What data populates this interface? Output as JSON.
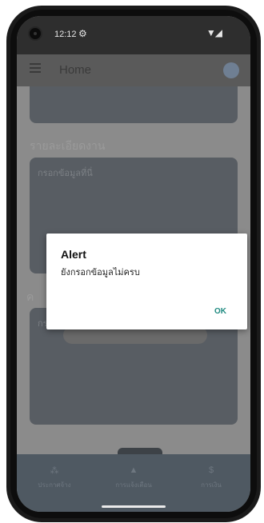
{
  "status_bar": {
    "time": "12:12"
  },
  "header": {
    "title": "Home"
  },
  "sections": {
    "details_label": "รายละเอียดงาน",
    "details_placeholder": "กรอกข้อมูลที่นี่",
    "second_label_partial": "ค",
    "second_placeholder_partial": "กรอก"
  },
  "bottom_nav": [
    {
      "label": "ประกาศจ้าง",
      "icon": "people-icon"
    },
    {
      "label": "การแจ้งเตือน",
      "icon": "bell-icon"
    },
    {
      "label": "การเงิน",
      "icon": "dollar-icon"
    }
  ],
  "dialog": {
    "title": "Alert",
    "message": "ยังกรอกข้อมูลไม่ครบ",
    "ok_label": "OK"
  }
}
